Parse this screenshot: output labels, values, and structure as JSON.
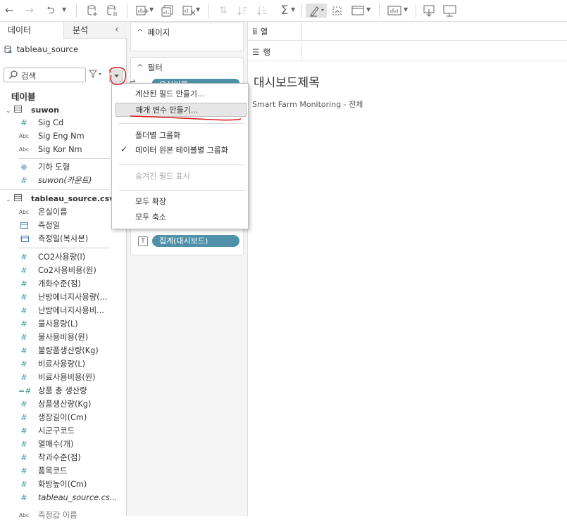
{
  "tabs": {
    "data": "데이터",
    "analysis": "분석"
  },
  "source": {
    "name": "tableau_source"
  },
  "search": {
    "placeholder": "검색"
  },
  "tables_heading": "테이블",
  "tables": [
    {
      "name": "suwon",
      "fields": [
        {
          "label": "Sig Cd",
          "type": "#"
        },
        {
          "label": "Sig Eng Nm",
          "type": "Abc"
        },
        {
          "label": "Sig Kor Nm",
          "type": "Abc"
        }
      ],
      "extra": [
        {
          "label": "기하 도형",
          "type": "globe"
        },
        {
          "label": "suwon(카운트)",
          "type": "#"
        }
      ]
    },
    {
      "name": "tableau_source.csv",
      "dimensions": [
        {
          "label": "온실이름",
          "type": "Abc"
        },
        {
          "label": "측정일",
          "type": "date"
        },
        {
          "label": "측정일(복사본)",
          "type": "date"
        }
      ],
      "measures": [
        {
          "label": "CO2사용량(l)"
        },
        {
          "label": "Co2사용비용(원)"
        },
        {
          "label": "개화수준(점)"
        },
        {
          "label": "난방에너지사용량(..."
        },
        {
          "label": "난방에너지사용비..."
        },
        {
          "label": "물사용량(L)"
        },
        {
          "label": "물사용비용(원)"
        },
        {
          "label": "불량품생산량(Kg)"
        },
        {
          "label": "비료사용량(L)"
        },
        {
          "label": "비료사용비용(원)"
        },
        {
          "label": "상품 총 생산량"
        },
        {
          "label": "상품생산량(Kg)"
        },
        {
          "label": "생장길이(Cm)"
        },
        {
          "label": "시군구코드"
        },
        {
          "label": "열매수(개)"
        },
        {
          "label": "착과수준(점)"
        },
        {
          "label": "품목코드"
        },
        {
          "label": "화방높이(Cm)"
        },
        {
          "label": "tableau_source.cs..."
        }
      ],
      "cutoff": "측정값 이름"
    }
  ],
  "shelves": {
    "pages": "페이지",
    "filters": "필터",
    "filter_pill": "온실이름",
    "marks_pill": "집계(대시보드)",
    "columns": "열",
    "rows": "행"
  },
  "canvas": {
    "title": "대시보드제목",
    "subtitle": "Smart Farm Monitoring - 전체"
  },
  "menu": {
    "create_calc": "계산된 필드 만들기...",
    "create_param": "매개 변수 만들기...",
    "group_folder": "폴더별 그룹화",
    "group_source": "데이터 원본 테이블별 그룹화",
    "show_hidden": "숨겨진 필드 표시",
    "expand_all": "모두 확장",
    "collapse_all": "모두 축소"
  },
  "colors": {
    "accent": "#4e91a8",
    "measure": "#3e9c93",
    "annotation": "#d9141a"
  }
}
